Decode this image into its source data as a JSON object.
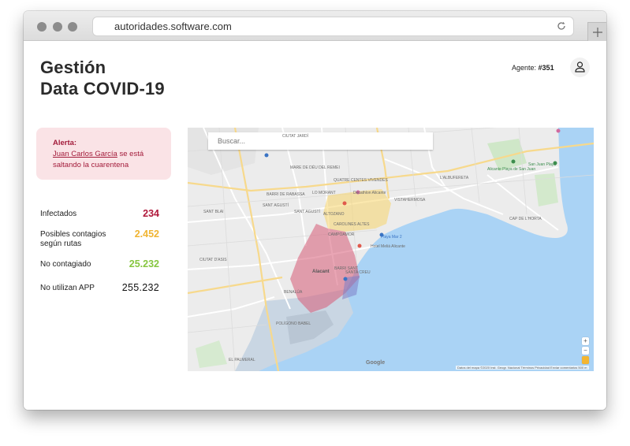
{
  "browser": {
    "url": "autoridades.software.com"
  },
  "header": {
    "title": "Gestión\nData COVID-19",
    "agent_label": "Agente:",
    "agent_id": "#351"
  },
  "alert": {
    "title": "Alerta:",
    "person": "Juan Carlos García",
    "message": " se está saltando la cuarentena"
  },
  "stats": [
    {
      "label": "Infectados",
      "value": "234",
      "color": "#b0193b"
    },
    {
      "label": "Posibles contagios según rutas",
      "value": "2.452",
      "color": "#f0b431"
    },
    {
      "label": "No contagiado",
      "value": "25.232",
      "color": "#86c63f"
    },
    {
      "label": "No utilizan APP",
      "value": "255.232",
      "color": "#111111"
    }
  ],
  "map": {
    "search_placeholder": "Buscar...",
    "zoom_in": "+",
    "zoom_out": "−",
    "google": "Google",
    "attribution": "Datos del mapa ©2020 Inst. Geogr. Nacional   Términos   Privacidad   Enviar comentarios   500 m",
    "labels": [
      {
        "text": "CIUTAT JARDÍ",
        "cls": ""
      },
      {
        "text": "MARE DE DÉU DEL REMEI",
        "cls": ""
      },
      {
        "text": "BARRI DE RABASSA",
        "cls": ""
      },
      {
        "text": "LO MORANT",
        "cls": ""
      },
      {
        "text": "QUATRE CENTES VIVENDES",
        "cls": ""
      },
      {
        "text": "SANT BLAI",
        "cls": ""
      },
      {
        "text": "SANT AGUSTÍ",
        "cls": ""
      },
      {
        "text": "ALTOZANO",
        "cls": ""
      },
      {
        "text": "VISTAHERMOSA",
        "cls": ""
      },
      {
        "text": "CAROLINES ALTES",
        "cls": ""
      },
      {
        "text": "CAMPOAMOR",
        "cls": ""
      },
      {
        "text": "Alacant",
        "cls": "big"
      },
      {
        "text": "BENALÚA",
        "cls": ""
      },
      {
        "text": "POLÍGONO BABEL",
        "cls": ""
      },
      {
        "text": "CIUTAT D'ASIS",
        "cls": ""
      },
      {
        "text": "EL PALMERAL",
        "cls": ""
      },
      {
        "text": "L'ALBUFERETA",
        "cls": ""
      },
      {
        "text": "Alicante Playa de San Juan",
        "cls": "green"
      },
      {
        "text": "San Juan Playa",
        "cls": "green"
      },
      {
        "text": "CAP DE L'HORTA",
        "cls": ""
      },
      {
        "text": "SANT AGUSTÍ",
        "cls": ""
      },
      {
        "text": "Playa Mar 2",
        "cls": "blue"
      },
      {
        "text": "Hotel Meliá Alicante",
        "cls": ""
      },
      {
        "text": "Decathlon Alicante",
        "cls": ""
      },
      {
        "text": "BARRI SANT",
        "cls": ""
      },
      {
        "text": "SANTA CREU",
        "cls": ""
      }
    ]
  }
}
